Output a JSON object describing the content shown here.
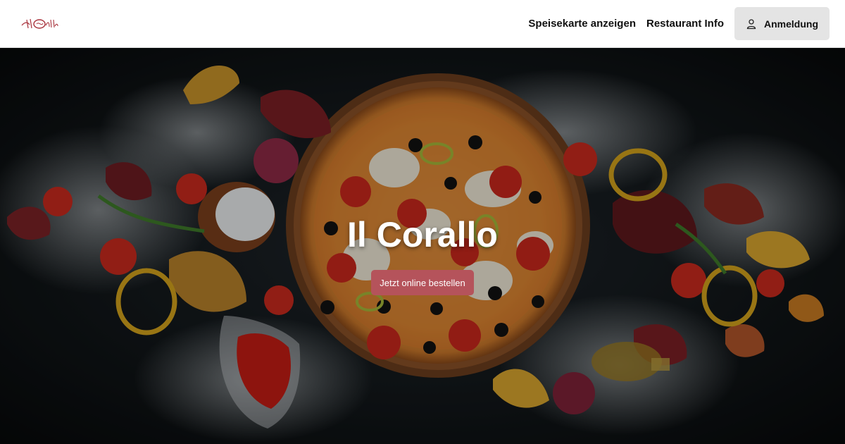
{
  "header": {
    "logo_alt": "Il Corallo",
    "nav": {
      "menu_label": "Speisekarte anzeigen",
      "info_label": "Restaurant Info",
      "login_label": "Anmeldung"
    }
  },
  "hero": {
    "title": "Il Corallo",
    "cta_label": "Jetzt online bestellen"
  },
  "colors": {
    "cta": "#b5535b",
    "login_bg": "#e4e4e4",
    "hero_bg": "#12171a",
    "logo": "#a8323c"
  },
  "icons": {
    "login": "user-icon",
    "logo": "il-corallo-logo"
  }
}
